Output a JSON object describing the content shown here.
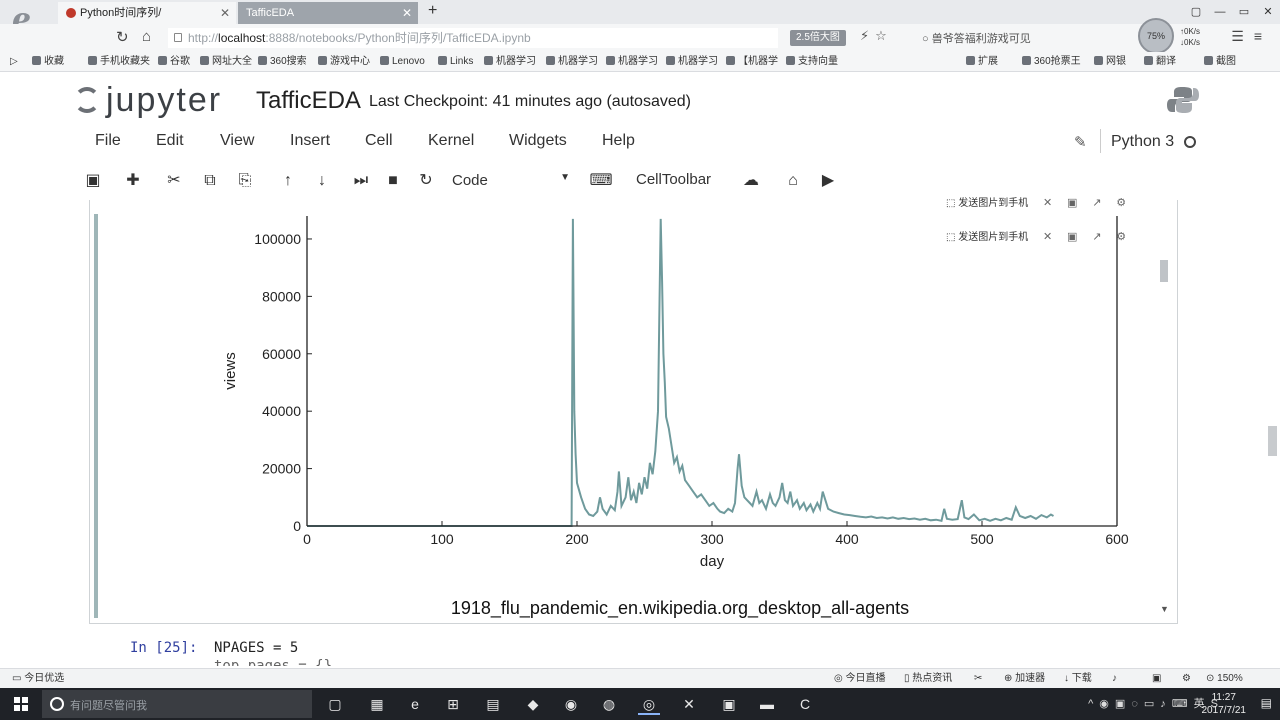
{
  "browser": {
    "logo": "e",
    "tabs": [
      {
        "label": "Python时间序列/",
        "active": false
      },
      {
        "label": "TafficEDA",
        "active": true
      }
    ],
    "new_tab": "+",
    "window_controls": [
      "▢",
      "—",
      "▭",
      "✕"
    ],
    "url_prefix": "http://",
    "url_host": "localhost",
    "url_path": ":8888/notebooks/Python时间序列/TafficEDA.ipynb",
    "zoom_badge": "2.5倍大图",
    "search_hint": "兽爷答福利游戏可见",
    "speed": {
      "up": "0K/s",
      "down": "0K/s",
      "label": "75%"
    }
  },
  "bookmarks": [
    "收藏",
    "手机收藏夹",
    "谷歌",
    "网址大全",
    "360搜索",
    "游戏中心",
    "Lenovo",
    "Links",
    "机器学习",
    "机器学习",
    "机器学习",
    "机器学习",
    "【机器学",
    "支持向量",
    "扩展",
    "360抢票王",
    "网银",
    "翻译",
    "截图"
  ],
  "jupyter": {
    "logo_text": "jupyter",
    "notebook_name": "TafficEDA",
    "checkpoint": "Last Checkpoint: 41 minutes ago (autosaved)",
    "menu": [
      "File",
      "Edit",
      "View",
      "Insert",
      "Cell",
      "Kernel",
      "Widgets",
      "Help"
    ],
    "kernel": "Python 3",
    "cell_type": "Code",
    "celltoolbar": "CellToolbar",
    "float_button_label": "发送图片到手机"
  },
  "chart_data": {
    "type": "line",
    "title": "1918_flu_pandemic_en.wikipedia.org_desktop_all-agents",
    "xlabel": "day",
    "ylabel": "views",
    "xlim": [
      0,
      600
    ],
    "ylim": [
      0,
      108000
    ],
    "xticks": [
      "0",
      "100",
      "200",
      "300",
      "400",
      "500",
      "600"
    ],
    "yticks": [
      "0",
      "20000",
      "40000",
      "60000",
      "80000",
      "100000"
    ],
    "color": "#6f9a9c",
    "points": [
      [
        0,
        0
      ],
      [
        196,
        0
      ],
      [
        197,
        107000
      ],
      [
        198,
        40000
      ],
      [
        199,
        25000
      ],
      [
        200,
        15000
      ],
      [
        203,
        10000
      ],
      [
        206,
        6000
      ],
      [
        209,
        4000
      ],
      [
        212,
        3500
      ],
      [
        215,
        5000
      ],
      [
        217,
        10000
      ],
      [
        219,
        6000
      ],
      [
        222,
        4000
      ],
      [
        225,
        7000
      ],
      [
        228,
        5500
      ],
      [
        230,
        12000
      ],
      [
        231,
        19000
      ],
      [
        233,
        7000
      ],
      [
        236,
        10000
      ],
      [
        238,
        17000
      ],
      [
        240,
        9000
      ],
      [
        242,
        12000
      ],
      [
        244,
        8000
      ],
      [
        246,
        15000
      ],
      [
        248,
        11000
      ],
      [
        250,
        17000
      ],
      [
        252,
        13000
      ],
      [
        254,
        22000
      ],
      [
        256,
        18000
      ],
      [
        258,
        26000
      ],
      [
        260,
        40000
      ],
      [
        261,
        75000
      ],
      [
        262,
        107000
      ],
      [
        263,
        85000
      ],
      [
        264,
        60000
      ],
      [
        265,
        50000
      ],
      [
        266,
        38000
      ],
      [
        268,
        34000
      ],
      [
        270,
        28000
      ],
      [
        272,
        22000
      ],
      [
        274,
        24000
      ],
      [
        276,
        19000
      ],
      [
        278,
        21000
      ],
      [
        280,
        16000
      ],
      [
        283,
        14000
      ],
      [
        286,
        12000
      ],
      [
        289,
        10000
      ],
      [
        292,
        11000
      ],
      [
        295,
        9000
      ],
      [
        298,
        7000
      ],
      [
        301,
        8000
      ],
      [
        304,
        6000
      ],
      [
        306,
        5000
      ],
      [
        309,
        4500
      ],
      [
        312,
        6000
      ],
      [
        315,
        5000
      ],
      [
        317,
        8000
      ],
      [
        319,
        20000
      ],
      [
        320,
        25000
      ],
      [
        322,
        14000
      ],
      [
        324,
        10000
      ],
      [
        326,
        9000
      ],
      [
        328,
        8000
      ],
      [
        330,
        7000
      ],
      [
        333,
        12000
      ],
      [
        335,
        8000
      ],
      [
        337,
        9000
      ],
      [
        340,
        6000
      ],
      [
        343,
        11000
      ],
      [
        345,
        8000
      ],
      [
        347,
        7000
      ],
      [
        350,
        10000
      ],
      [
        352,
        15000
      ],
      [
        354,
        9000
      ],
      [
        356,
        8000
      ],
      [
        358,
        12000
      ],
      [
        360,
        7000
      ],
      [
        363,
        9000
      ],
      [
        365,
        6000
      ],
      [
        368,
        8000
      ],
      [
        370,
        5500
      ],
      [
        373,
        7500
      ],
      [
        375,
        5000
      ],
      [
        378,
        8000
      ],
      [
        380,
        6000
      ],
      [
        382,
        12000
      ],
      [
        384,
        9000
      ],
      [
        386,
        6000
      ],
      [
        390,
        5000
      ],
      [
        394,
        4500
      ],
      [
        398,
        4000
      ],
      [
        402,
        3800
      ],
      [
        406,
        3500
      ],
      [
        410,
        3200
      ],
      [
        414,
        3000
      ],
      [
        418,
        3300
      ],
      [
        422,
        2800
      ],
      [
        426,
        3000
      ],
      [
        430,
        2600
      ],
      [
        434,
        3000
      ],
      [
        438,
        2500
      ],
      [
        442,
        2800
      ],
      [
        446,
        2400
      ],
      [
        450,
        2600
      ],
      [
        454,
        2200
      ],
      [
        458,
        2500
      ],
      [
        462,
        2000
      ],
      [
        466,
        2200
      ],
      [
        470,
        1800
      ],
      [
        472,
        6000
      ],
      [
        474,
        2500
      ],
      [
        478,
        2200
      ],
      [
        482,
        2400
      ],
      [
        485,
        9000
      ],
      [
        487,
        3000
      ],
      [
        490,
        2400
      ],
      [
        494,
        4000
      ],
      [
        498,
        2000
      ],
      [
        502,
        2500
      ],
      [
        506,
        1800
      ],
      [
        510,
        2500
      ],
      [
        514,
        2000
      ],
      [
        518,
        2800
      ],
      [
        522,
        2200
      ],
      [
        525,
        6500
      ],
      [
        528,
        3500
      ],
      [
        532,
        2800
      ],
      [
        536,
        3500
      ],
      [
        540,
        2500
      ],
      [
        544,
        3800
      ],
      [
        548,
        3000
      ],
      [
        551,
        4000
      ],
      [
        553,
        3500
      ]
    ]
  },
  "code_cell": {
    "prompt": "In [25]:",
    "line1": "NPAGES = 5",
    "line2": "top_pages = {}"
  },
  "statusbar": {
    "left": "今日优选",
    "right": [
      "今日直播",
      "热点资讯",
      "",
      "加速器",
      "下载",
      "",
      "",
      "",
      "150%"
    ]
  },
  "taskbar": {
    "search_placeholder": "有问题尽管问我",
    "tray_ime": "英",
    "time": "11:27",
    "date": "2017/7/21"
  }
}
